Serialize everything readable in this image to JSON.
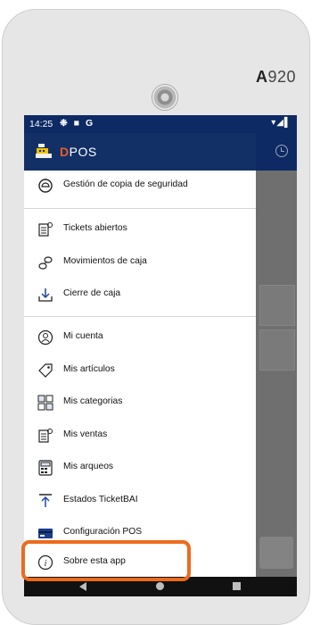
{
  "device": {
    "brand_letter": "A",
    "brand_number": "920"
  },
  "status_bar": {
    "time": "14:25",
    "notifications": "❉ ■ G",
    "system_icons": "▾◢▌"
  },
  "app": {
    "brand_prefix": "D",
    "brand_name": "POS"
  },
  "menu": {
    "items": [
      {
        "label": "Gestión de copia de seguridad",
        "icon": "backup-icon"
      },
      {
        "label": "Tickets abiertos",
        "icon": "tickets-icon"
      },
      {
        "label": "Movimientos de caja",
        "icon": "coins-icon"
      },
      {
        "label": "Cierre de caja",
        "icon": "download-icon"
      },
      {
        "label": "Mi cuenta",
        "icon": "account-icon"
      },
      {
        "label": "Mis artículos",
        "icon": "tag-icon"
      },
      {
        "label": "Mis categorias",
        "icon": "categories-icon"
      },
      {
        "label": "Mis ventas",
        "icon": "sales-icon"
      },
      {
        "label": "Mis arqueos",
        "icon": "cash-count-icon"
      },
      {
        "label": "Estados TicketBAI",
        "icon": "upload-icon"
      },
      {
        "label": "Configuración POS",
        "icon": "card-icon"
      },
      {
        "label": "Sobre esta app",
        "icon": "info-icon"
      }
    ]
  },
  "colors": {
    "app_bar": "#0d2a64",
    "accent": "#f15a1e",
    "highlight": "#ec6b1c"
  }
}
